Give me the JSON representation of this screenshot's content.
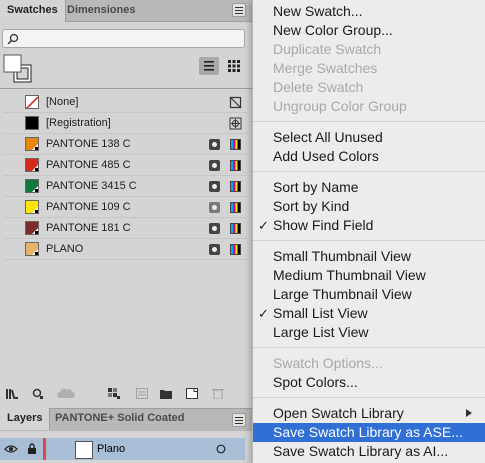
{
  "panel": {
    "tabs": [
      "Swatches",
      "Dimensiones"
    ],
    "search": {
      "placeholder": "",
      "value": ""
    },
    "swatches": [
      {
        "label": "[None]",
        "color": "#ffffff",
        "type": "none"
      },
      {
        "label": "[Registration]",
        "color": "#000000",
        "type": "registration"
      },
      {
        "label": "PANTONE 138 C",
        "color": "#e8850f",
        "type": "spot"
      },
      {
        "label": "PANTONE 485 C",
        "color": "#d52b1e",
        "type": "spot"
      },
      {
        "label": "PANTONE 3415 C",
        "color": "#0b7a3c",
        "type": "spot"
      },
      {
        "label": "PANTONE 109 C",
        "color": "#ffe600",
        "type": "spot"
      },
      {
        "label": "PANTONE 181 C",
        "color": "#7a2a2a",
        "type": "spot"
      },
      {
        "label": "PLANO",
        "color": "#e6b36a",
        "type": "spot"
      }
    ],
    "layers_tabs": [
      "Layers",
      "PANTONE+ Solid Coated"
    ],
    "layer": {
      "label": "Plano",
      "color": "#e0474c"
    }
  },
  "menu": {
    "highlight": "#2f6fd6",
    "groups": [
      [
        {
          "label": "New Swatch...",
          "enabled": true
        },
        {
          "label": "New Color Group...",
          "enabled": true
        },
        {
          "label": "Duplicate Swatch",
          "enabled": false
        },
        {
          "label": "Merge Swatches",
          "enabled": false
        },
        {
          "label": "Delete Swatch",
          "enabled": false
        },
        {
          "label": "Ungroup Color Group",
          "enabled": false
        }
      ],
      [
        {
          "label": "Select All Unused",
          "enabled": true
        },
        {
          "label": "Add Used Colors",
          "enabled": true
        }
      ],
      [
        {
          "label": "Sort by Name",
          "enabled": true
        },
        {
          "label": "Sort by Kind",
          "enabled": true
        },
        {
          "label": "Show Find Field",
          "enabled": true,
          "checked": true
        }
      ],
      [
        {
          "label": "Small Thumbnail View",
          "enabled": true
        },
        {
          "label": "Medium Thumbnail View",
          "enabled": true
        },
        {
          "label": "Large Thumbnail View",
          "enabled": true
        },
        {
          "label": "Small List View",
          "enabled": true,
          "checked": true
        },
        {
          "label": "Large List View",
          "enabled": true
        }
      ],
      [
        {
          "label": "Swatch Options...",
          "enabled": false
        },
        {
          "label": "Spot Colors...",
          "enabled": true
        }
      ],
      [
        {
          "label": "Open Swatch Library",
          "enabled": true,
          "submenu": true
        },
        {
          "label": "Save Swatch Library as ASE...",
          "enabled": true,
          "highlighted": true
        },
        {
          "label": "Save Swatch Library as AI...",
          "enabled": true
        }
      ]
    ]
  }
}
